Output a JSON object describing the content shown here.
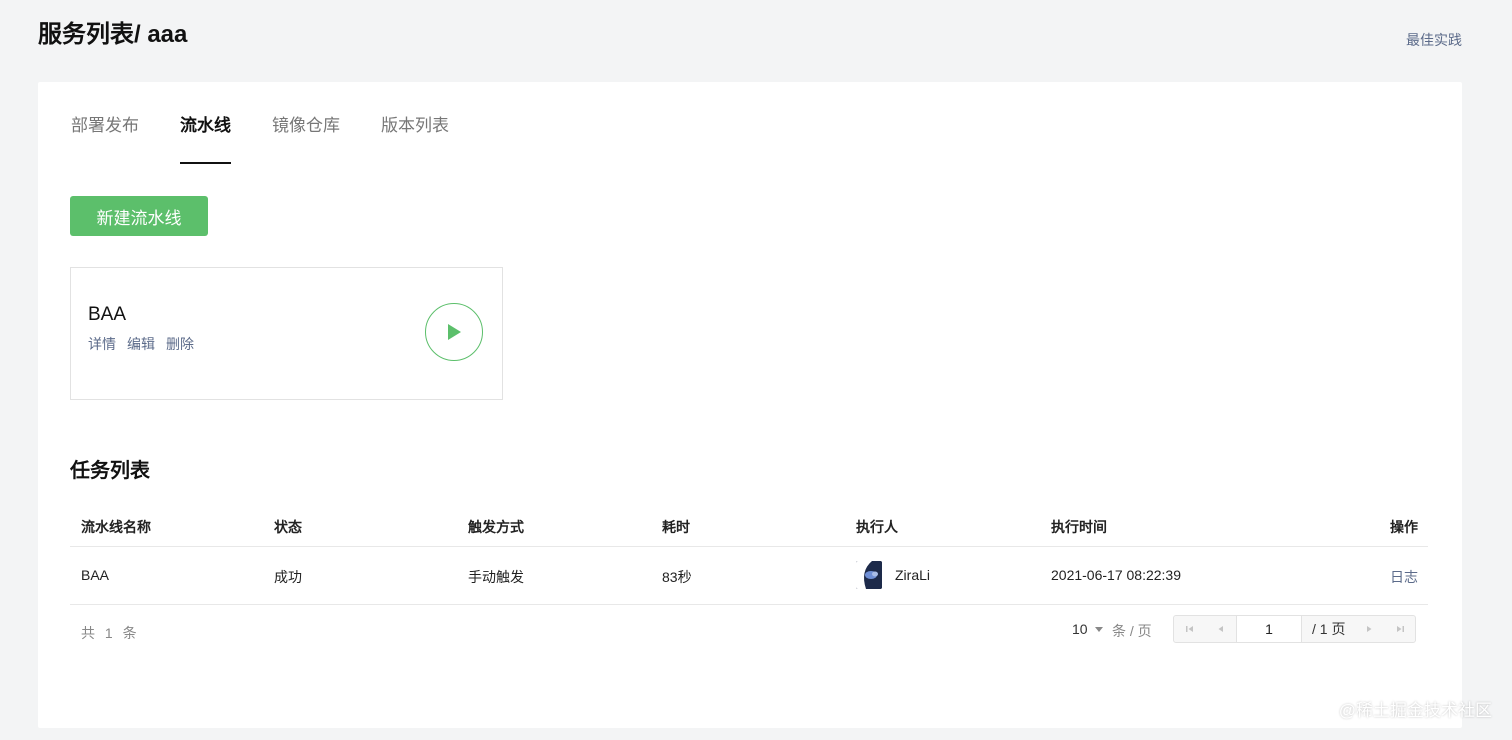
{
  "header": {
    "title": "服务列表/ aaa",
    "best_practice": "最佳实践"
  },
  "tabs": [
    {
      "label": "部署发布",
      "active": false
    },
    {
      "label": "流水线",
      "active": true
    },
    {
      "label": "镜像仓库",
      "active": false
    },
    {
      "label": "版本列表",
      "active": false
    }
  ],
  "new_pipeline_label": "新建流水线",
  "pipeline_card": {
    "name": "BAA",
    "actions": [
      "详情",
      "编辑",
      "删除"
    ],
    "run_icon": "play-icon"
  },
  "task_section": {
    "title": "任务列表"
  },
  "task_table": {
    "columns": [
      "流水线名称",
      "状态",
      "触发方式",
      "耗时",
      "执行人",
      "执行时间",
      "操作"
    ],
    "rows": [
      {
        "name": "BAA",
        "status": "成功",
        "trigger": "手动触发",
        "duration": "83秒",
        "executor": "ZiraLi",
        "time": "2021-06-17 08:22:39",
        "op": "日志"
      }
    ]
  },
  "pagination": {
    "total_text": "共 1 条",
    "page_size": "10",
    "per_page_label": "条 / 页",
    "current_page": "1",
    "total_pages_text": "/ 1 页"
  },
  "watermark": "@稀土掘金技术社区",
  "colors": {
    "accent_green": "#5cbf6b",
    "link": "#5c6b8a"
  }
}
